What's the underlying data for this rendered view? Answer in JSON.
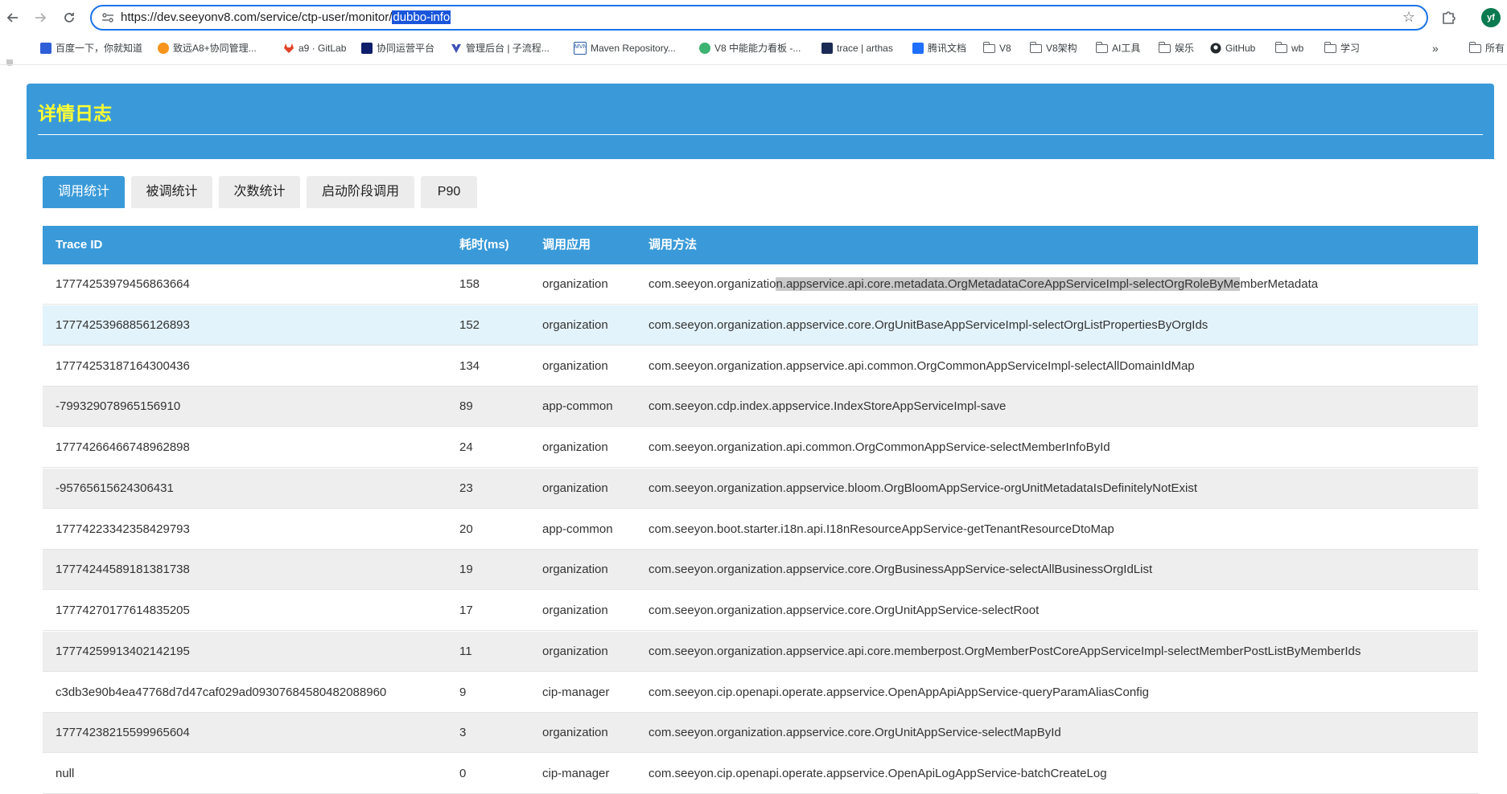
{
  "browser": {
    "url_prefix": "https://dev.seeyonv8.com/service/ctp-user/monitor/",
    "url_selected": "dubbo-info",
    "profile_initials": "yf",
    "bookmarks": [
      {
        "label": "百度一下，你就知道",
        "icon": "baidu-icon"
      },
      {
        "label": "致远A8+协同管理...",
        "icon": "seeyon-icon"
      },
      {
        "label": "a9 · GitLab",
        "icon": "gitlab-icon"
      },
      {
        "label": "协同运营平台",
        "icon": "platform-icon"
      },
      {
        "label": "管理后台 | 子流程...",
        "icon": "vue-icon"
      },
      {
        "label": "Maven Repository...",
        "icon": "maven-icon"
      },
      {
        "label": "V8 中能能力看板 -...",
        "icon": "v8-icon"
      },
      {
        "label": "trace | arthas",
        "icon": "arthas-icon"
      },
      {
        "label": "腾讯文档",
        "icon": "tencent-docs-icon"
      },
      {
        "label": "V8",
        "icon": "folder-icon"
      },
      {
        "label": "V8架构",
        "icon": "folder-icon"
      },
      {
        "label": "AI工具",
        "icon": "folder-icon"
      },
      {
        "label": "娱乐",
        "icon": "folder-icon"
      },
      {
        "label": "GitHub",
        "icon": "github-icon"
      },
      {
        "label": "wb",
        "icon": "folder-icon"
      },
      {
        "label": "学习",
        "icon": "folder-icon"
      },
      {
        "label": "所有",
        "icon": "folder-icon"
      }
    ]
  },
  "page": {
    "title": "详情日志",
    "tabs": [
      "调用统计",
      "被调统计",
      "次数统计",
      "启动阶段调用",
      "P90"
    ],
    "active_tab": 0,
    "colors": {
      "accent": "#3a9ad9",
      "title": "#ffff33"
    }
  },
  "table": {
    "headers": [
      "Trace ID",
      "耗时(ms)",
      "调用应用",
      "调用方法"
    ],
    "rows": [
      {
        "trace_id": "17774253979456863664",
        "ms": "158",
        "app": "organization",
        "method_a": "com.seeyon.organizatio",
        "method_b": "n.appservice.api.core.metadata.OrgMetadataCoreAppServiceImpl-selectOrgRoleByMe",
        "method_c": "mberMetadata"
      },
      {
        "trace_id": "17774253968856126893",
        "ms": "152",
        "app": "organization",
        "method_a": "com.seeyon.organization.appservice.core.OrgUnitBaseAppServiceImpl-selectOrgListPropertiesByOrgIds",
        "method_b": "",
        "method_c": ""
      },
      {
        "trace_id": "17774253187164300436",
        "ms": "134",
        "app": "organization",
        "method_a": "com.seeyon.organization.appservice.api.common.OrgCommonAppServiceImpl-selectAllDomainIdMap",
        "method_b": "",
        "method_c": ""
      },
      {
        "trace_id": "-799329078965156910",
        "ms": "89",
        "app": "app-common",
        "method_a": "com.seeyon.cdp.index.appservice.IndexStoreAppServiceImpl-save",
        "method_b": "",
        "method_c": ""
      },
      {
        "trace_id": "17774266466748962898",
        "ms": "24",
        "app": "organization",
        "method_a": "com.seeyon.organization.api.common.OrgCommonAppService-selectMemberInfoById",
        "method_b": "",
        "method_c": ""
      },
      {
        "trace_id": "-95765615624306431",
        "ms": "23",
        "app": "organization",
        "method_a": "com.seeyon.organization.appservice.bloom.OrgBloomAppService-orgUnitMetadataIsDefinitelyNotExist",
        "method_b": "",
        "method_c": ""
      },
      {
        "trace_id": "17774223342358429793",
        "ms": "20",
        "app": "app-common",
        "method_a": "com.seeyon.boot.starter.i18n.api.I18nResourceAppService-getTenantResourceDtoMap",
        "method_b": "",
        "method_c": ""
      },
      {
        "trace_id": "17774244589181381738",
        "ms": "19",
        "app": "organization",
        "method_a": "com.seeyon.organization.appservice.core.OrgBusinessAppService-selectAllBusinessOrgIdList",
        "method_b": "",
        "method_c": ""
      },
      {
        "trace_id": "17774270177614835205",
        "ms": "17",
        "app": "organization",
        "method_a": "com.seeyon.organization.appservice.core.OrgUnitAppService-selectRoot",
        "method_b": "",
        "method_c": ""
      },
      {
        "trace_id": "17774259913402142195",
        "ms": "11",
        "app": "organization",
        "method_a": "com.seeyon.organization.appservice.api.core.memberpost.OrgMemberPostCoreAppServiceImpl-selectMemberPostListByMemberIds",
        "method_b": "",
        "method_c": ""
      },
      {
        "trace_id": "c3db3e90b4ea47768d7d47caf029ad09307684580482088960",
        "ms": "9",
        "app": "cip-manager",
        "method_a": "com.seeyon.cip.openapi.operate.appservice.OpenAppApiAppService-queryParamAliasConfig",
        "method_b": "",
        "method_c": ""
      },
      {
        "trace_id": "17774238215599965604",
        "ms": "3",
        "app": "organization",
        "method_a": "com.seeyon.organization.appservice.core.OrgUnitAppService-selectMapById",
        "method_b": "",
        "method_c": ""
      },
      {
        "trace_id": "null",
        "ms": "0",
        "app": "cip-manager",
        "method_a": "com.seeyon.cip.openapi.operate.appservice.OpenApiLogAppService-batchCreateLog",
        "method_b": "",
        "method_c": ""
      }
    ]
  }
}
